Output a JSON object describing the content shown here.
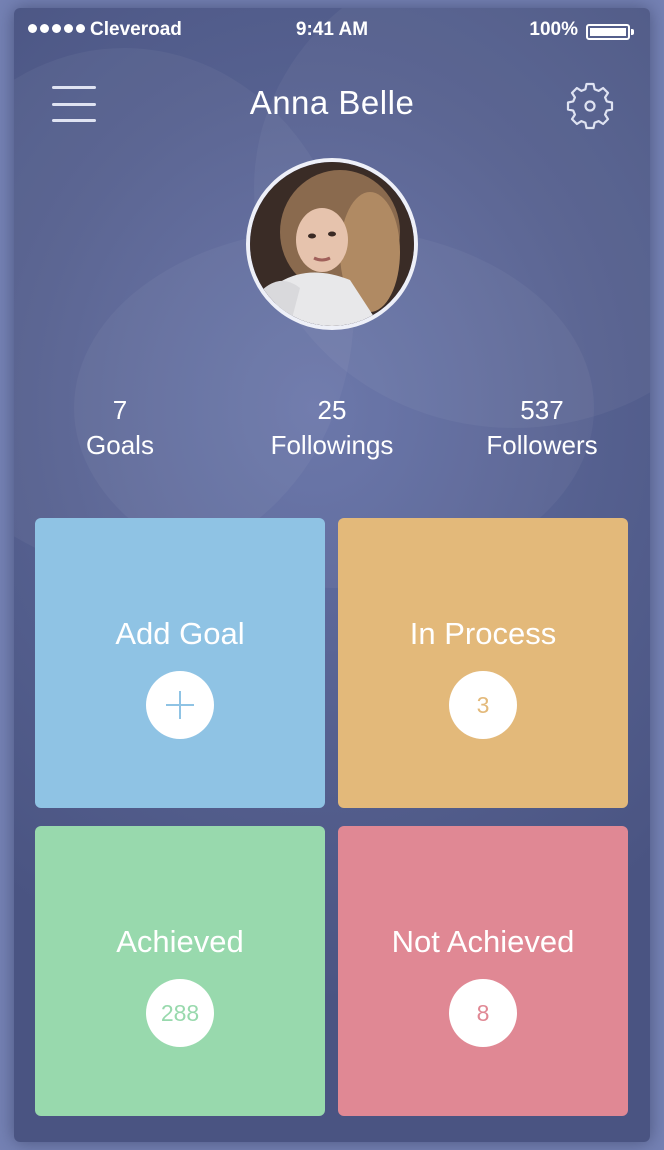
{
  "status_bar": {
    "carrier": "Cleveroad",
    "time": "9:41 AM",
    "battery": "100%"
  },
  "header": {
    "title": "Anna Belle",
    "menu_icon": "hamburger-menu-icon",
    "settings_icon": "gear-icon"
  },
  "stats": [
    {
      "value": "7",
      "label": "Goals"
    },
    {
      "value": "25",
      "label": "Followings"
    },
    {
      "value": "537",
      "label": "Followers"
    }
  ],
  "tiles": {
    "add_goal": {
      "label": "Add Goal",
      "icon": "plus-icon",
      "color": "#8fc3e4"
    },
    "in_process": {
      "label": "In Process",
      "count": "3",
      "color": "#e3b97a"
    },
    "achieved": {
      "label": "Achieved",
      "count": "288",
      "color": "#98d9ad"
    },
    "not_achieved": {
      "label": "Not Achieved",
      "count": "8",
      "color": "#e08894"
    }
  },
  "colors": {
    "background": "#55608f",
    "text": "#ffffff"
  }
}
